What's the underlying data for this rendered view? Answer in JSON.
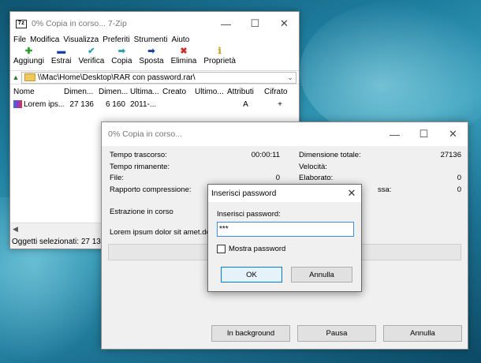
{
  "main_window": {
    "title": "0% Copia in corso... 7-Zip",
    "app_icon_text": "7z",
    "menu": [
      "File",
      "Modifica",
      "Visualizza",
      "Preferiti",
      "Strumenti",
      "Aiuto"
    ],
    "toolbar": [
      {
        "label": "Aggiungi",
        "icon": "plus-icon",
        "glyph": "✚",
        "color": "#2e9a2e"
      },
      {
        "label": "Estrai",
        "icon": "minus-icon",
        "glyph": "▬",
        "color": "#1a3fa8"
      },
      {
        "label": "Verifica",
        "icon": "check-icon",
        "glyph": "✔",
        "color": "#2aa0b0"
      },
      {
        "label": "Copia",
        "icon": "copy-arrow-icon",
        "glyph": "➡",
        "color": "#2aa0b0"
      },
      {
        "label": "Sposta",
        "icon": "move-arrow-icon",
        "glyph": "➡",
        "color": "#1a3fa8"
      },
      {
        "label": "Elimina",
        "icon": "delete-x-icon",
        "glyph": "✖",
        "color": "#d22a2a"
      },
      {
        "label": "Proprietà",
        "icon": "info-icon",
        "glyph": "ℹ",
        "color": "#c9a22a"
      }
    ],
    "address": "\\\\Mac\\Home\\Desktop\\RAR con password.rar\\",
    "columns": [
      "Nome",
      "Dimen...",
      "Dimen...",
      "Ultima...",
      "Creato",
      "Ultimo...",
      "Attributi",
      "Cifrato"
    ],
    "rows": [
      {
        "name": "Lorem ips...",
        "size": "27 136",
        "packed": "6 160",
        "modified": "2011-...",
        "created": "",
        "accessed": "",
        "attributes": "A",
        "encrypted": "+"
      }
    ],
    "status": "Oggetti selezionati:  27 13"
  },
  "progress_window": {
    "title": "0% Copia in corso...",
    "left_stats": [
      {
        "label": "Tempo trascorso:",
        "value": "00:00:11"
      },
      {
        "label": "Tempo rimanente:",
        "value": ""
      },
      {
        "label": "File:",
        "value": "0"
      },
      {
        "label": "Rapporto compressione:",
        "value": ""
      }
    ],
    "right_stats": [
      {
        "label": "Dimensione totale:",
        "value": "27136"
      },
      {
        "label": "Velocità:",
        "value": ""
      },
      {
        "label": "Elaborato:",
        "value": "0"
      },
      {
        "label": "ssa:",
        "value": "0"
      }
    ],
    "operation": "Estrazione in corso",
    "current_file": "Lorem ipsum dolor sit amet.doc",
    "progress_percent": 0,
    "buttons": {
      "background": "In background",
      "pause": "Pausa",
      "cancel": "Annulla"
    }
  },
  "password_dialog": {
    "title": "Inserisci password",
    "label": "Inserisci password:",
    "value": "***",
    "show_password": "Mostra password",
    "ok": "OK",
    "cancel": "Annulla"
  }
}
